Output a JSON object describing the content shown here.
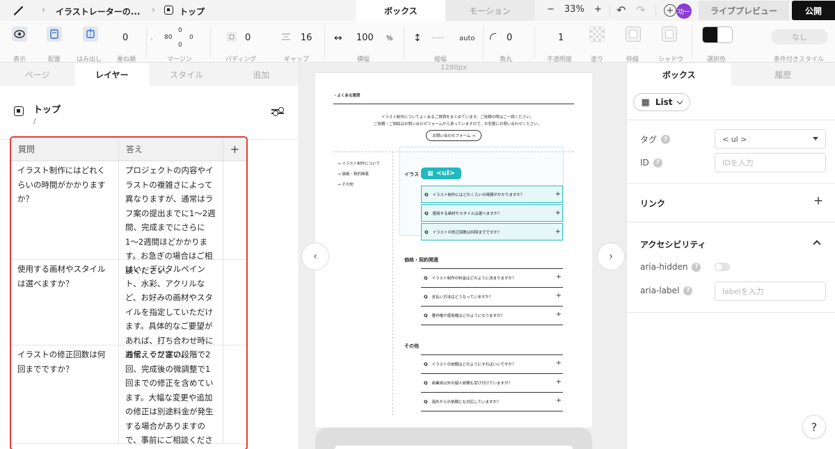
{
  "topbar": {
    "breadcrumb": "イラストレーターの...",
    "page_name": "トップ",
    "modes": [
      "ボックス",
      "モーション"
    ],
    "zoom": {
      "minus": "−",
      "value": "33%",
      "plus": "+"
    },
    "avatar": "功一",
    "preview": "ライブプレビュー",
    "publish": "公開"
  },
  "toolbar": {
    "display": "表示",
    "layout": "配置",
    "overflow": "はみ出し",
    "zindex_value": "0",
    "zindex_label": "重ね順",
    "margin": {
      "top": "0",
      "left": "80",
      "right": "0",
      "bottom": "0",
      "label": "マージン"
    },
    "padding": {
      "value": "0",
      "label": "パディング"
    },
    "gap": {
      "value": "16",
      "label": "ギャップ"
    },
    "width": {
      "value": "100",
      "unit": "%",
      "label": "横幅"
    },
    "height": {
      "value": "----",
      "unit": "auto",
      "label": "縦幅"
    },
    "radius": {
      "value": "0",
      "label": "角丸"
    },
    "opacity": {
      "value": "1",
      "label": "不透明度"
    },
    "fill": "塗り",
    "border": "枠線",
    "shadow": "シャドウ",
    "selection_color": "選択色",
    "conditional_button": "なし",
    "conditional_label": "条件付きスタイル"
  },
  "left_panel": {
    "tabs": [
      "ページ",
      "レイヤー",
      "スタイル",
      "追加"
    ],
    "active_tab": "レイヤー",
    "title": "トップ",
    "path": "/",
    "table": {
      "headers": [
        "質問",
        "答え",
        "+"
      ],
      "rows": [
        {
          "q": "イラスト制作にはどれくらいの時間がかかりますか？",
          "a": "プロジェクトの内容やイラストの複雑さによって異なりますが、通常はラフ案の提出までに1〜2週間、完成までにさらに1〜2週間ほどかかります。お急ぎの場合はご相談ください。"
        },
        {
          "q": "使用する画材やスタイルは選べますか？",
          "a": "はい、デジタルペイント、水彩、アクリルなど、お好みの画材やスタイルを指定していただけます。具体的なご要望があれば、打ち合わせ時にお伝えください。"
        },
        {
          "q": "イラストの修正回数は何回までですか？",
          "a": "通常、ラフ案の段階で2回、完成後の微調整で1回までの修正を含めています。大幅な変更や追加の修正は別途料金が発生する場合がありますので、事前にご相談ください。"
        }
      ]
    }
  },
  "canvas": {
    "ruler": "1280px",
    "page": {
      "heading": "・よくある質問",
      "intro1": "イラスト制作についてよくあるご質問をまとめています。ご依頼の際はご一読ください。",
      "intro2": "ご依頼・ご相談はお問い合わせフォームから承っていますので、お気軽にお問い合わせください。",
      "contact_button": "お問い合わせフォーム →",
      "sidenav": [
        "→ イラスト制作について",
        "→ 価格・契約関連",
        "→ その他"
      ],
      "badge": "<ul>",
      "section1_title": "イラス",
      "section1_items": [
        "イラスト制作にはどれくらいの時間がかかりますか？",
        "使用する画材やスタイルは選べますか？",
        "イラストの修正回数は何回までですか？"
      ],
      "section2_title": "価格・契約関連",
      "section2_items": [
        "イラスト制作の料金はどのように決まりますか？",
        "支払い方法はどうなっていますか？",
        "著作権や使用権はどのようになりますか？"
      ],
      "section3_title": "その他",
      "section3_items": [
        "イラストの依頼はどのようにすればいいですか？",
        "商業用以外の個人依頼も受け付けていますか？",
        "海外からの依頼にも対応していますか？"
      ],
      "q_mark": "Q",
      "plus": "+"
    },
    "arrow_left": "‹",
    "arrow_right": "›"
  },
  "right_panel": {
    "tabs": [
      "ボックス",
      "履歴"
    ],
    "active_tab": "ボックス",
    "component": "List",
    "tag_label": "タグ",
    "tag_value": "< ul >",
    "id_label": "ID",
    "id_placeholder": "IDを入力",
    "link_section": "リンク",
    "accessibility_section": "アクセシビリティ",
    "aria_hidden_label": "aria-hidden",
    "aria_label_label": "aria-label",
    "aria_label_placeholder": "labelを入力",
    "help_button": "?"
  }
}
